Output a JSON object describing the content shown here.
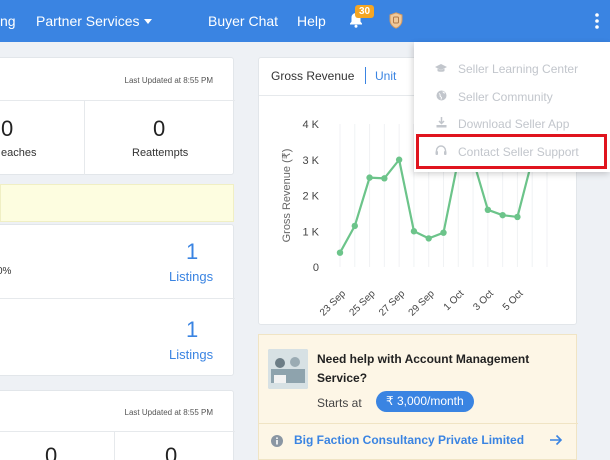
{
  "topbar": {
    "nav_fragment": "ng",
    "partner_services": "Partner Services",
    "buyer_chat": "Buyer Chat",
    "help": "Help",
    "notification_count": "30"
  },
  "left_top_card": {
    "last_updated": "Last Updated at 8:55 PM",
    "stat1_value": "0",
    "stat1_label": "eaches",
    "stat2_value": "0",
    "stat2_label": "Reattempts"
  },
  "listings_card": {
    "percent_fragment": "0%",
    "row1_value": "1",
    "row1_label": "Listings",
    "row2_value": "1",
    "row2_label": "Listings"
  },
  "left_bottom_card": {
    "last_updated": "Last Updated at 8:55 PM",
    "stat1_value": "0",
    "stat2_value": "0"
  },
  "chart_card": {
    "tab_active": "Gross Revenue",
    "tab_other": "Unit"
  },
  "chart_data": {
    "type": "line",
    "ylabel": "Gross Revenue (₹)",
    "xlabel": "",
    "ylim": [
      0,
      4000
    ],
    "ytick_labels": [
      "0",
      "1 K",
      "2 K",
      "3 K",
      "4 K"
    ],
    "x_labels": [
      "23 Sep",
      "25 Sep",
      "27 Sep",
      "29 Sep",
      "1 Oct",
      "3 Oct",
      "5 Oct"
    ],
    "series": [
      {
        "color": "#6cc48a",
        "x": [
          0,
          1,
          2,
          3,
          4,
          5,
          6,
          7,
          8,
          9,
          10,
          11,
          12,
          13,
          14
        ],
        "values": [
          400,
          1150,
          2500,
          2480,
          3000,
          1000,
          800,
          960,
          3000,
          3000,
          1600,
          1450,
          1400,
          3000,
          3000
        ]
      }
    ]
  },
  "dropdown": {
    "items": [
      {
        "icon": "graduation-cap-icon",
        "label": "Seller Learning Center"
      },
      {
        "icon": "globe-icon",
        "label": "Seller Community"
      },
      {
        "icon": "download-icon",
        "label": "Download Seller App"
      },
      {
        "icon": "headset-icon",
        "label": "Contact Seller Support"
      }
    ]
  },
  "promo": {
    "title": "Need help with Account Management Service?",
    "starts_at": "Starts at",
    "price": "₹ 3,000/month",
    "company": "Big Faction Consultancy Private Limited"
  },
  "colors": {
    "topbar": "#3a84e2",
    "accent": "#3a84e2",
    "line": "#6cc48a",
    "highlight": "#e0141e",
    "notice": "#fdfde0"
  }
}
